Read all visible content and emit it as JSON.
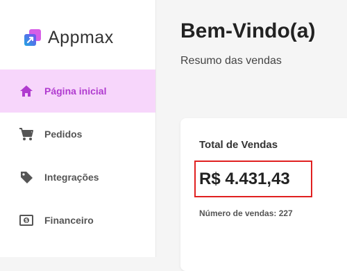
{
  "brand": {
    "name": "Appmax"
  },
  "sidebar": {
    "items": [
      {
        "label": "Página inicial",
        "icon": "home-icon",
        "active": true
      },
      {
        "label": "Pedidos",
        "icon": "cart-icon",
        "active": false
      },
      {
        "label": "Integrações",
        "icon": "tag-icon",
        "active": false
      },
      {
        "label": "Financeiro",
        "icon": "money-icon",
        "active": false
      }
    ]
  },
  "main": {
    "title": "Bem-Vindo(a)",
    "subtitle": "Resumo das vendas",
    "sales_card": {
      "title": "Total de Vendas",
      "total": "R$ 4.431,43",
      "count_text": "Número de vendas: 227"
    }
  },
  "colors": {
    "accent": "#b03bcf",
    "active_bg": "#f7d6fb",
    "highlight_border": "#e02020"
  }
}
